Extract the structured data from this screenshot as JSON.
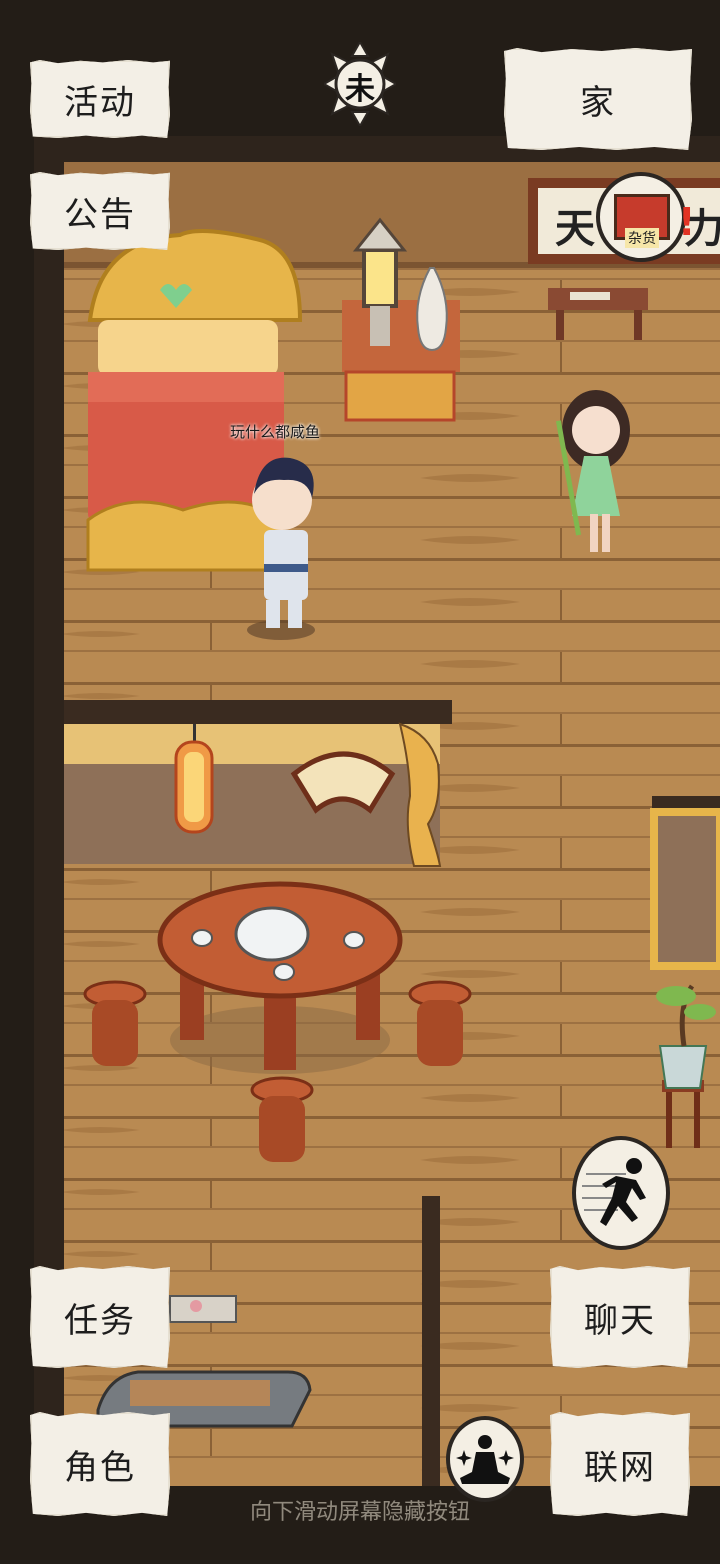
{
  "top_left_buttons": [
    {
      "label": "活动"
    },
    {
      "label": "公告"
    }
  ],
  "top_right_button": {
    "label": "家"
  },
  "bottom_left_buttons": [
    {
      "label": "任务"
    },
    {
      "label": "角色"
    }
  ],
  "bottom_right_buttons": [
    {
      "label": "聊天"
    },
    {
      "label": "联网"
    }
  ],
  "time_emblem": {
    "glyph": "未",
    "icon": "sun-icon"
  },
  "wall_plaque": {
    "left_char": "天",
    "right_char": "力"
  },
  "shop_badge": {
    "label": "杂货",
    "icon": "shop-icon"
  },
  "player": {
    "speech": "玩什么都咸鱼"
  },
  "action_buttons": {
    "run_icon": "running-figure-icon",
    "meditate_icon": "meditating-figure-icon"
  },
  "footer_hint": "向下滑动屏幕隐藏按钮"
}
